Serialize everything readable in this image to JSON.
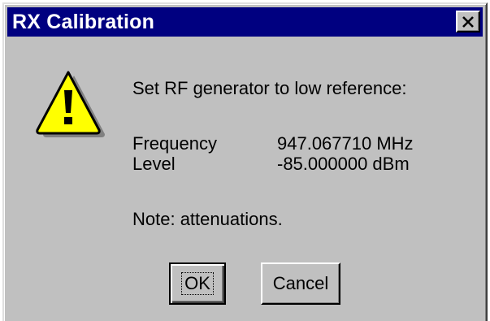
{
  "window": {
    "title": "RX Calibration",
    "close_label": "×"
  },
  "icon": {
    "name": "warning-icon",
    "color": "#ffff00"
  },
  "message": {
    "instruction": "Set RF generator to low reference:",
    "frequency_label": "Frequency",
    "frequency_value": "947.067710 MHz",
    "level_label": "Level",
    "level_value": "-85.000000 dBm",
    "note": "Note: attenuations."
  },
  "buttons": {
    "ok_label": "OK",
    "cancel_label": "Cancel"
  },
  "colors": {
    "titlebar": "#000080",
    "face": "#c0c0c0"
  }
}
